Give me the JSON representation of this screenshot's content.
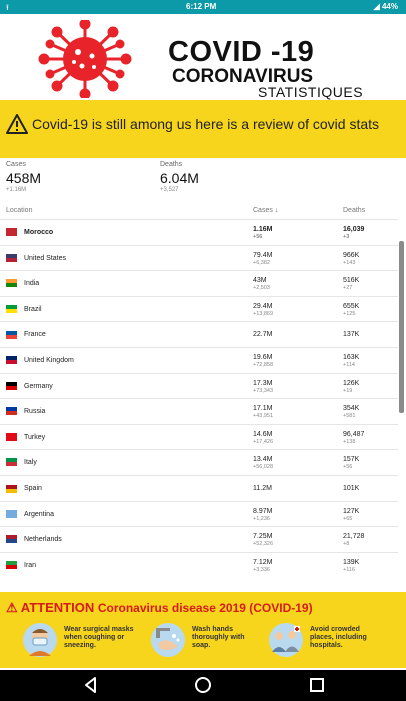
{
  "status_bar": {
    "time": "6:12 PM",
    "battery": "44%",
    "left_icon": "upload-arrow-icon"
  },
  "banner": {
    "title": "COVID -19",
    "subtitle": "CORONAVIRUS",
    "subtitle2": "STATISTIQUES"
  },
  "notice": {
    "text": "Covid-19 is still among us here is a review of covid stats"
  },
  "summary": {
    "cases": {
      "label": "Cases",
      "value": "458M",
      "change": "+1.16M"
    },
    "deaths": {
      "label": "Deaths",
      "value": "6.04M",
      "change": "+3,527"
    }
  },
  "table": {
    "headers": {
      "location": "Location",
      "cases": "Cases ↓",
      "deaths": "Deaths"
    },
    "rows": [
      {
        "country": "Morocco",
        "cases": "1.16M",
        "cases_new": "+56",
        "deaths": "16,039",
        "deaths_new": "+3",
        "flag": [
          "#c1272d",
          "#c1272d"
        ]
      },
      {
        "country": "United States",
        "cases": "79.4M",
        "cases_new": "+6,382",
        "deaths": "966K",
        "deaths_new": "+143",
        "flag": [
          "#3c3b6e",
          "#b22234"
        ]
      },
      {
        "country": "India",
        "cases": "43M",
        "cases_new": "+2,503",
        "deaths": "516K",
        "deaths_new": "+27",
        "flag": [
          "#ff9933",
          "#138808"
        ]
      },
      {
        "country": "Brazil",
        "cases": "29.4M",
        "cases_new": "+13,869",
        "deaths": "655K",
        "deaths_new": "+125",
        "flag": [
          "#009c3b",
          "#ffdf00"
        ]
      },
      {
        "country": "France",
        "cases": "22.7M",
        "cases_new": "",
        "deaths": "137K",
        "deaths_new": "",
        "flag": [
          "#0055a4",
          "#ef4135"
        ]
      },
      {
        "country": "United Kingdom",
        "cases": "19.6M",
        "cases_new": "+72,858",
        "deaths": "163K",
        "deaths_new": "+114",
        "flag": [
          "#012169",
          "#c8102e"
        ]
      },
      {
        "country": "Germany",
        "cases": "17.3M",
        "cases_new": "+73,343",
        "deaths": "126K",
        "deaths_new": "+19",
        "flag": [
          "#000000",
          "#dd0000"
        ]
      },
      {
        "country": "Russia",
        "cases": "17.1M",
        "cases_new": "+43,951",
        "deaths": "354K",
        "deaths_new": "+581",
        "flag": [
          "#0039a6",
          "#d52b1e"
        ]
      },
      {
        "country": "Turkey",
        "cases": "14.6M",
        "cases_new": "+17,426",
        "deaths": "96,487",
        "deaths_new": "+138",
        "flag": [
          "#e30a17",
          "#e30a17"
        ]
      },
      {
        "country": "Italy",
        "cases": "13.4M",
        "cases_new": "+56,028",
        "deaths": "157K",
        "deaths_new": "+56",
        "flag": [
          "#009246",
          "#ce2b37"
        ]
      },
      {
        "country": "Spain",
        "cases": "11.2M",
        "cases_new": "",
        "deaths": "101K",
        "deaths_new": "",
        "flag": [
          "#aa151b",
          "#f1bf00"
        ]
      },
      {
        "country": "Argentina",
        "cases": "8.97M",
        "cases_new": "+1,236",
        "deaths": "127K",
        "deaths_new": "+65",
        "flag": [
          "#74acdf",
          "#74acdf"
        ]
      },
      {
        "country": "Netherlands",
        "cases": "7.25M",
        "cases_new": "+52,326",
        "deaths": "21,728",
        "deaths_new": "+8",
        "flag": [
          "#ae1c28",
          "#21468b"
        ]
      },
      {
        "country": "Iran",
        "cases": "7.12M",
        "cases_new": "+3,336",
        "deaths": "139K",
        "deaths_new": "+116",
        "flag": [
          "#239f40",
          "#da0000"
        ]
      }
    ]
  },
  "attention": {
    "title": "ATTENTION",
    "subtitle": "Coronavirus disease 2019 (COVID-19)",
    "tips": [
      {
        "icon": "face-mask-icon",
        "text": "Wear surgical masks when coughing or sneezing."
      },
      {
        "icon": "wash-hands-icon",
        "text": "Wash hands thoroughly with soap."
      },
      {
        "icon": "crowd-icon",
        "text": "Avoid crowded places, including hospitals."
      }
    ]
  },
  "colors": {
    "accent_yellow": "#f7d51d",
    "status_bar": "#0d9aa8",
    "attention_red": "#d61b1b",
    "virus_red": "#e8232a"
  },
  "nav": {
    "back": "back-icon",
    "home": "home-icon",
    "recents": "recents-icon"
  }
}
